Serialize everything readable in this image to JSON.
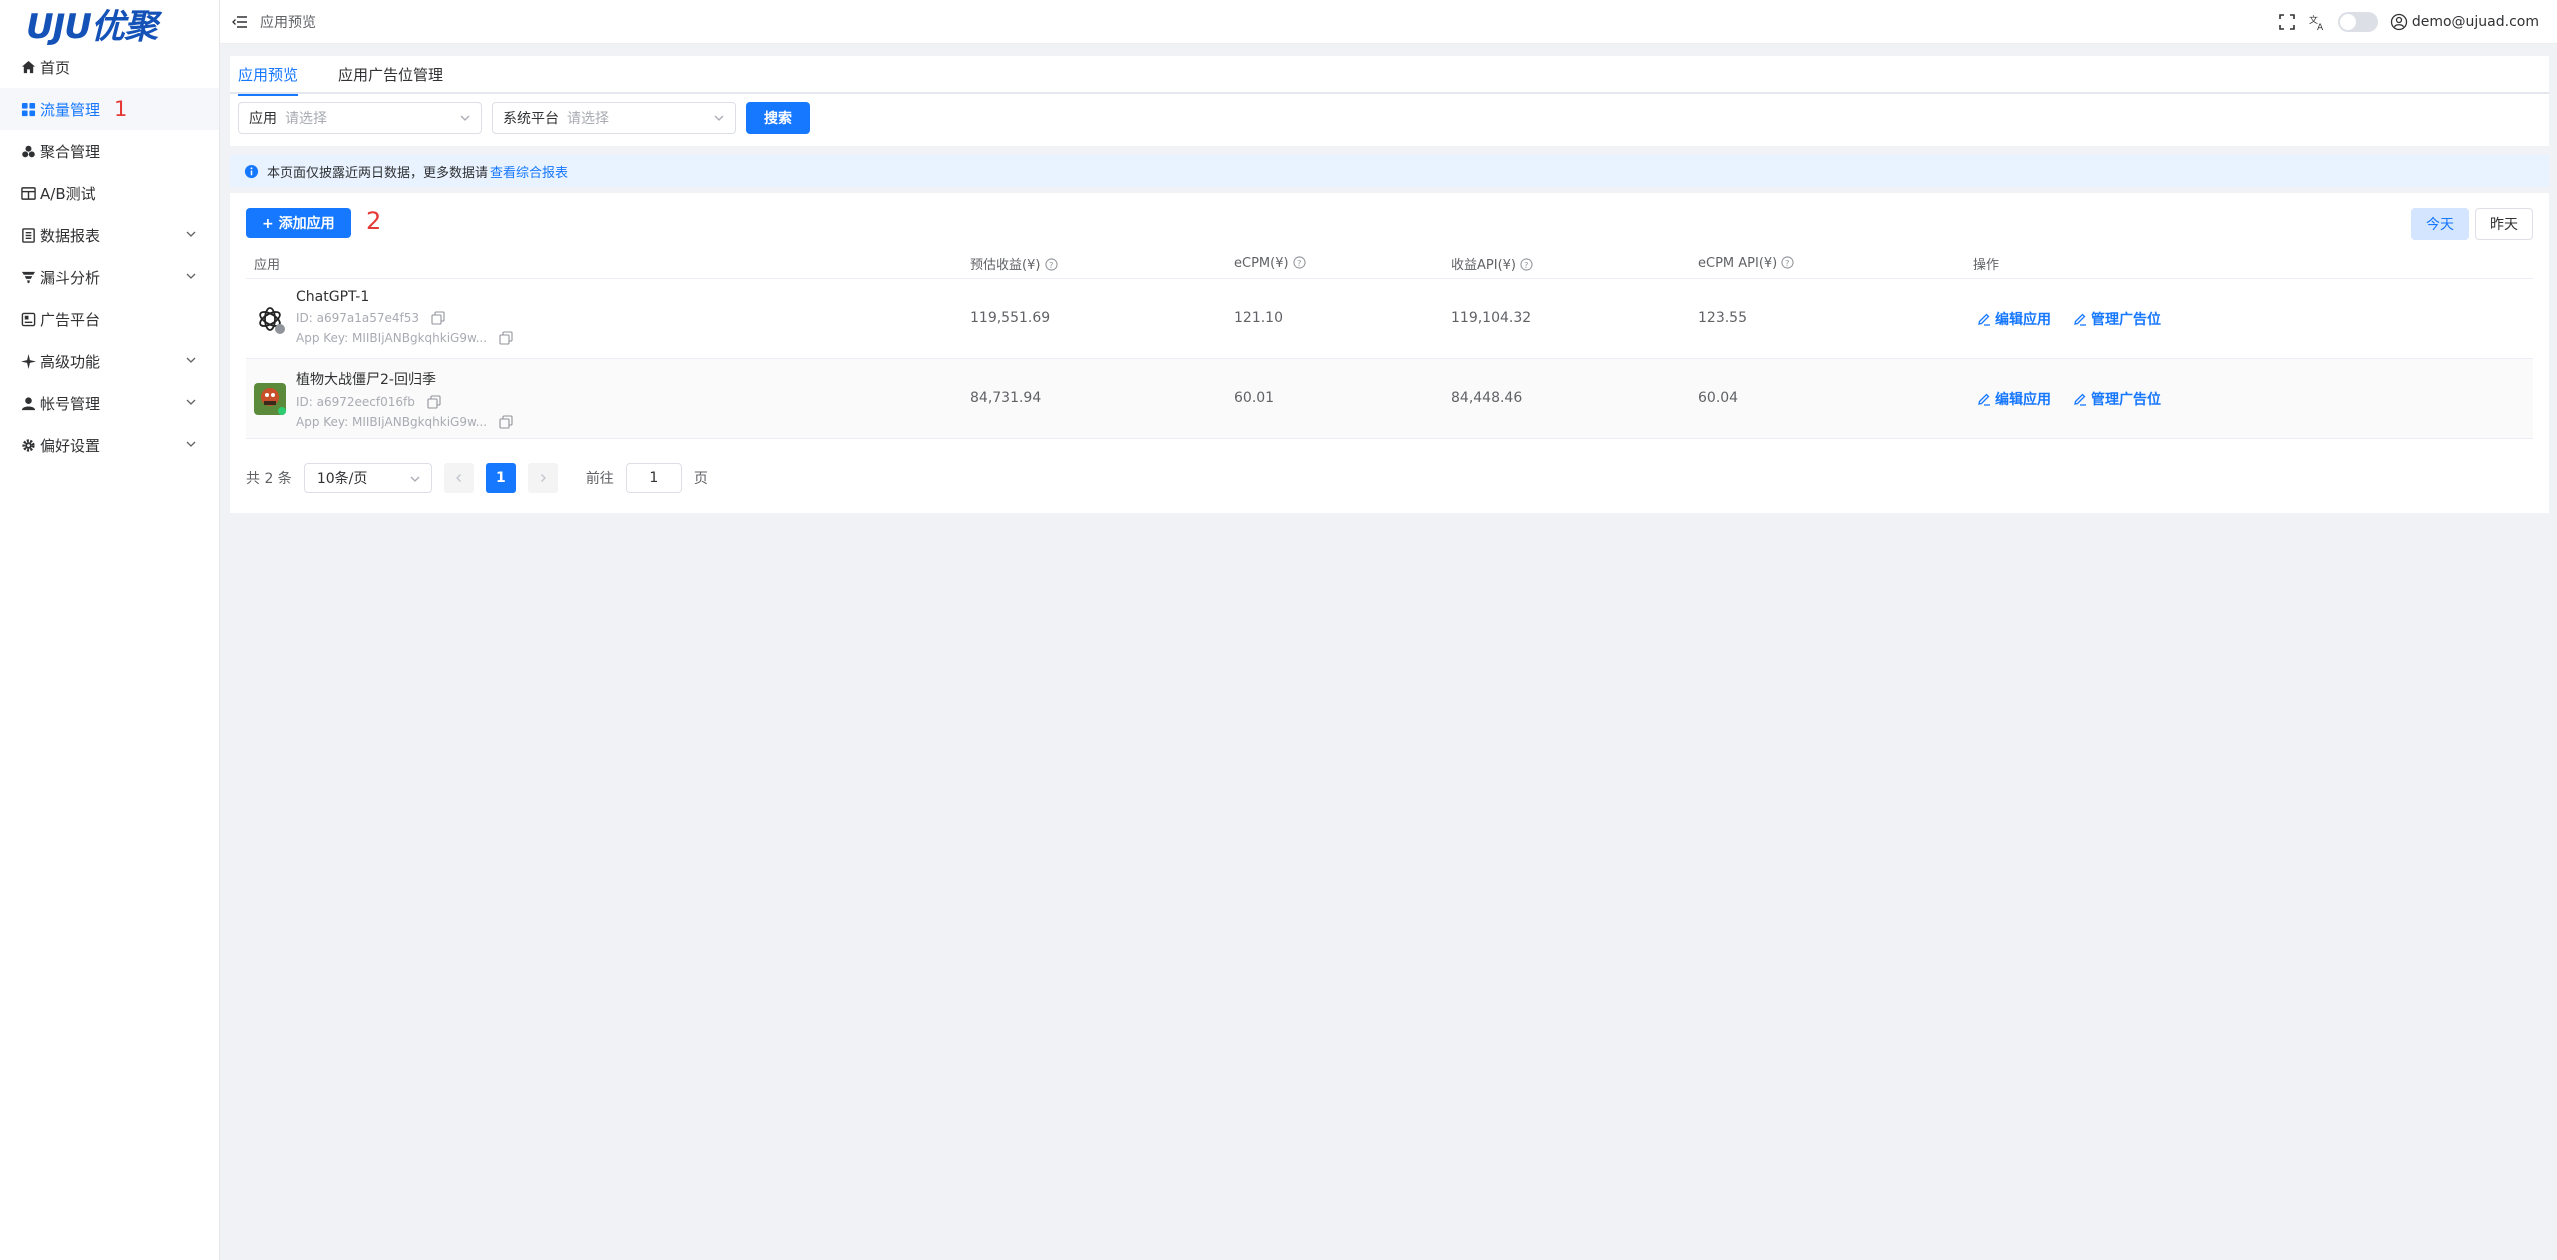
{
  "brand": {
    "logo_text": "UJU优聚"
  },
  "sidebar": {
    "items": [
      {
        "label": "首页",
        "icon": "home-icon",
        "has_arrow": false
      },
      {
        "label": "流量管理",
        "icon": "grid-icon",
        "has_arrow": false,
        "active": true,
        "annotation": "1"
      },
      {
        "label": "聚合管理",
        "icon": "cluster-icon",
        "has_arrow": false
      },
      {
        "label": "A/B测试",
        "icon": "ab-test-icon",
        "has_arrow": false
      },
      {
        "label": "数据报表",
        "icon": "report-icon",
        "has_arrow": true
      },
      {
        "label": "漏斗分析",
        "icon": "funnel-icon",
        "has_arrow": true
      },
      {
        "label": "广告平台",
        "icon": "ad-platform-icon",
        "has_arrow": false
      },
      {
        "label": "高级功能",
        "icon": "sparkle-icon",
        "has_arrow": true
      },
      {
        "label": "帐号管理",
        "icon": "user-icon",
        "has_arrow": true
      },
      {
        "label": "偏好设置",
        "icon": "gear-icon",
        "has_arrow": true
      }
    ]
  },
  "header": {
    "breadcrumb": "应用预览",
    "user_email": "demo@ujuad.com"
  },
  "tabs": [
    {
      "label": "应用预览",
      "active": true
    },
    {
      "label": "应用广告位管理",
      "active": false
    }
  ],
  "filters": {
    "app": {
      "label": "应用",
      "placeholder": "请选择"
    },
    "platform": {
      "label": "系统平台",
      "placeholder": "请选择"
    },
    "search_label": "搜索"
  },
  "notice": {
    "text": "本页面仅披露近两日数据，更多数据请",
    "link": "查看综合报表"
  },
  "toolbar": {
    "add_label": "+ 添加应用",
    "annotation": "2",
    "today": "今天",
    "yesterday": "昨天"
  },
  "table": {
    "headers": {
      "app": "应用",
      "est_revenue": "预估收益(¥)",
      "ecpm": "eCPM(¥)",
      "api_revenue": "收益API(¥)",
      "ecpm_api": "eCPM API(¥)",
      "ops": "操作"
    },
    "rows": [
      {
        "name": "ChatGPT-1",
        "id": "ID: a697a1a57e4f53",
        "app_key": "App Key: MIIBIjANBgkqhkiG9w...",
        "est_revenue": "119,551.69",
        "ecpm": "121.10",
        "api_revenue": "119,104.32",
        "ecpm_api": "123.55",
        "edit": "编辑应用",
        "manage": "管理广告位"
      },
      {
        "name": "植物大战僵尸2-回归季",
        "id": "ID: a6972eecf016fb",
        "app_key": "App Key: MIIBIjANBgkqhkiG9w...",
        "est_revenue": "84,731.94",
        "ecpm": "60.01",
        "api_revenue": "84,448.46",
        "ecpm_api": "60.04",
        "edit": "编辑应用",
        "manage": "管理广告位"
      }
    ]
  },
  "pagination": {
    "total": "共 2 条",
    "page_size": "10条/页",
    "current": "1",
    "goto_prefix": "前往",
    "goto_value": "1",
    "goto_suffix": "页"
  },
  "colors": {
    "accent": "#1677ff",
    "annotation": "#e53935",
    "notice_bg": "#e8f3ff"
  }
}
